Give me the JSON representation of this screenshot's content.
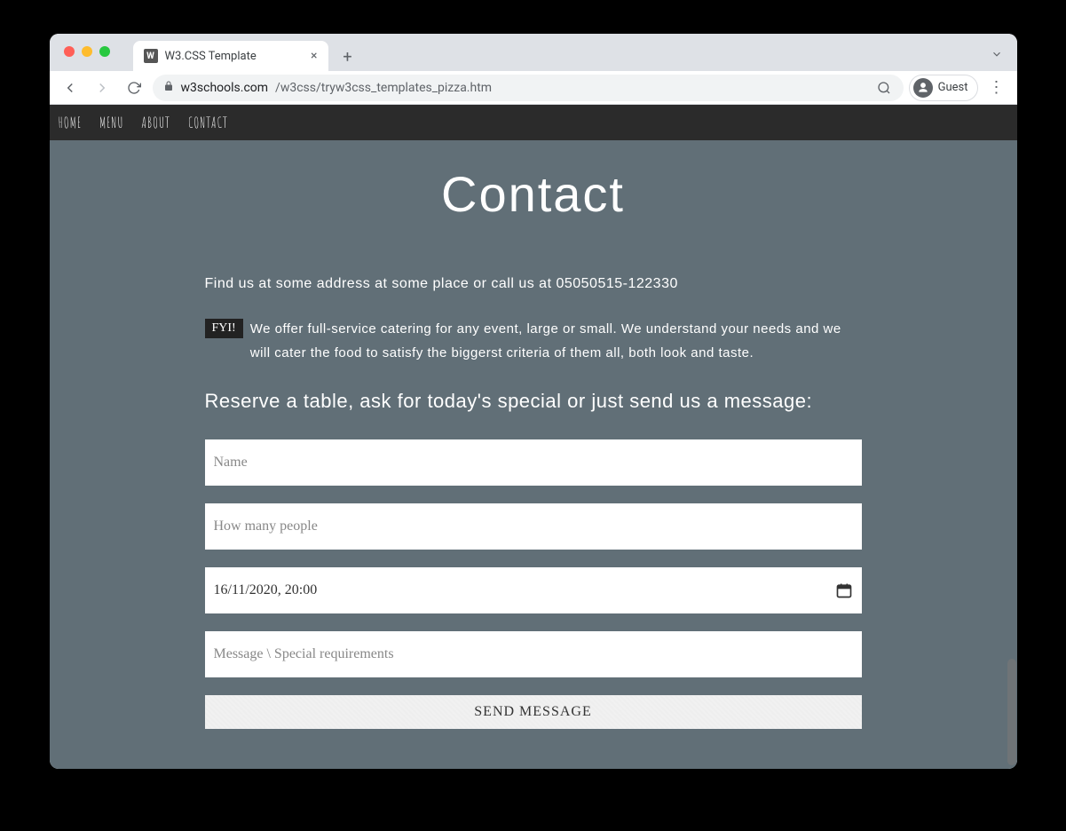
{
  "browser": {
    "tab_title": "W3.CSS Template",
    "favicon_text": "W",
    "url_host": "w3schools.com",
    "url_path": "/w3css/tryw3css_templates_pizza.htm",
    "guest_label": "Guest"
  },
  "nav": {
    "items": [
      "HOME",
      "MENU",
      "ABOUT",
      "CONTACT"
    ]
  },
  "contact": {
    "title": "Contact",
    "intro": "Find us at some address at some place or call us at 05050515-122330",
    "fyi_tag": "FYI!",
    "fyi_text": "We offer full-service catering for any event, large or small. We understand your needs and we will cater the food to satisfy the biggerst criteria of them all, both look and taste.",
    "reserve_heading": "Reserve a table, ask for today's special or just send us a message:",
    "form": {
      "name_placeholder": "Name",
      "people_placeholder": "How many people",
      "date_value": "16/11/2020, 20:00",
      "message_placeholder": "Message \\ Special requirements",
      "submit_label": "SEND MESSAGE"
    }
  }
}
